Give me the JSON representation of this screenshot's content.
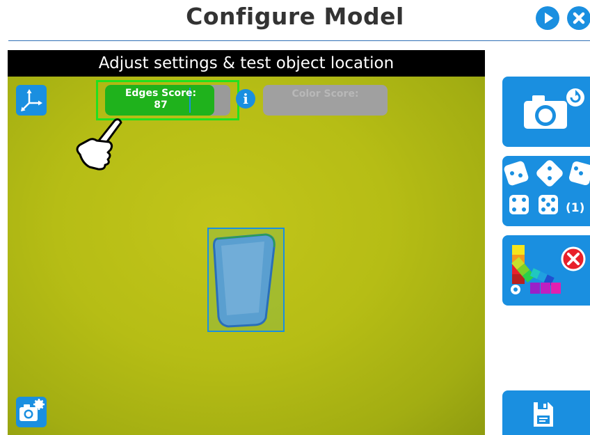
{
  "header": {
    "title": "Configure Model",
    "play_icon": "play-icon",
    "close_icon": "close-icon"
  },
  "camera_view": {
    "title": "Adjust settings & test object location",
    "edges_score": {
      "label": "Edges Score:",
      "value": "87",
      "fill_fraction": 0.87,
      "threshold_fraction": 0.67
    },
    "color_score": {
      "label": "Color Score:",
      "value": ""
    },
    "info_icon": "info-icon",
    "axes_icon": "axes-icon",
    "hand_icon": "pointing-hand-icon",
    "camera_settings_icon": "camera-settings-icon"
  },
  "sidebar": {
    "retake_photo_icon": "camera-refresh-icon",
    "dice_count": "(1)",
    "color_palette_icon": "color-palette-icon",
    "save_icon": "save-icon"
  },
  "colors": {
    "accent": "#1a8fe0",
    "success": "#1fb21c",
    "highlight": "#22e020",
    "danger": "#e8202a",
    "panel_title_bg": "#000000",
    "disabled": "#a0a0a0"
  }
}
